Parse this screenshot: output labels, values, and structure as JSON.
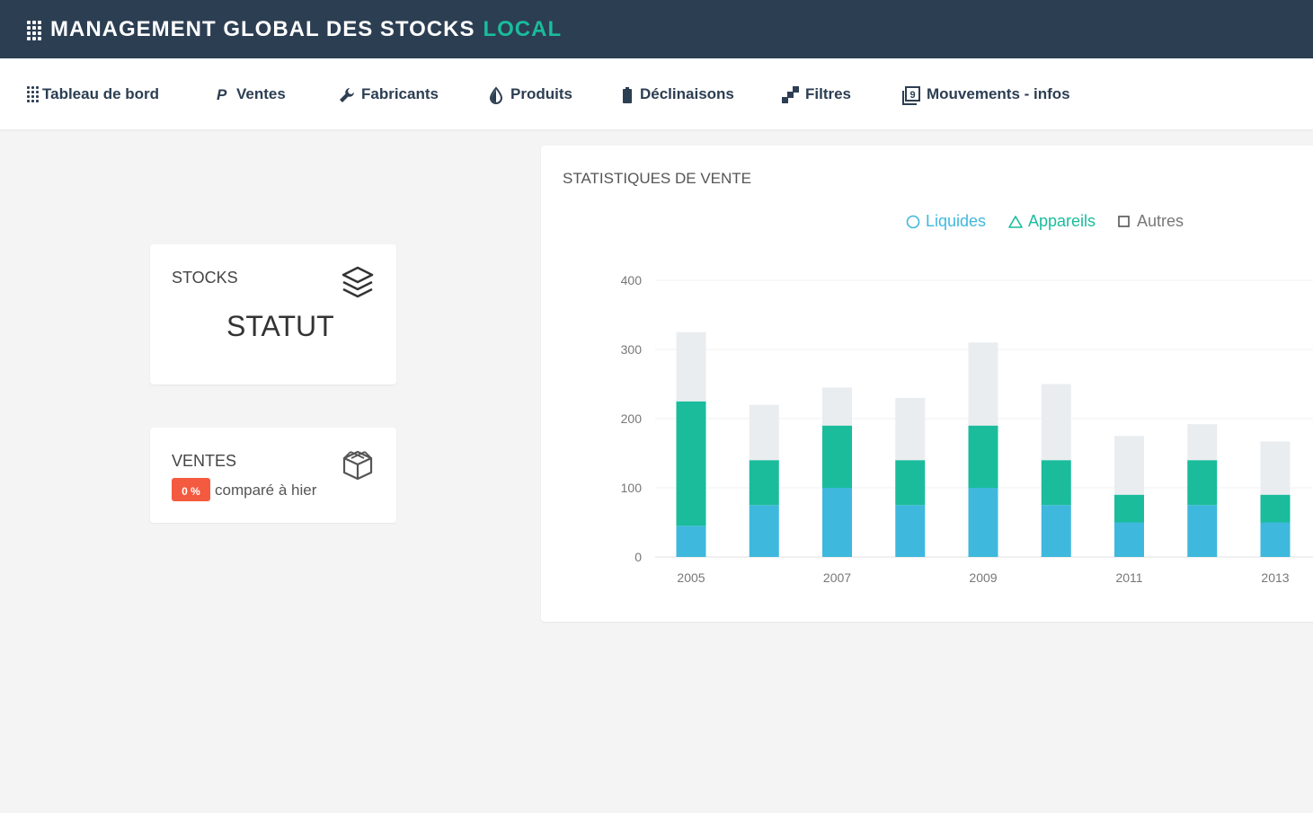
{
  "app": {
    "title": "MANAGEMENT GLOBAL DES STOCKS",
    "title_accent": "LOCAL"
  },
  "nav": {
    "items": [
      {
        "label": "Tableau de bord",
        "icon": "dashboard-grid-icon"
      },
      {
        "label": "Ventes",
        "icon": "paypal-icon"
      },
      {
        "label": "Fabricants",
        "icon": "wrench-icon"
      },
      {
        "label": "Produits",
        "icon": "drop-icon"
      },
      {
        "label": "Déclinaisons",
        "icon": "battery-icon"
      },
      {
        "label": "Filtres",
        "icon": "steps-icon"
      },
      {
        "label": "Mouvements - infos",
        "icon": "number-9-box-icon"
      }
    ]
  },
  "cards": {
    "stocks": {
      "label": "STOCKS",
      "value": "STATUT",
      "icon": "layers-icon"
    },
    "ventes": {
      "label": "VENTES",
      "badge": "0 %",
      "compare": "comparé à hier",
      "icon": "box-icon"
    }
  },
  "chart": {
    "title": "STATISTIQUES DE VENTE",
    "legend": [
      {
        "label": "Liquides",
        "shape": "circle",
        "color": "#3fb8dd"
      },
      {
        "label": "Appareils",
        "shape": "triangle",
        "color": "#1abc9c"
      },
      {
        "label": "Autres",
        "shape": "square",
        "color": "#777777"
      }
    ]
  },
  "chart_data": {
    "type": "bar",
    "stacked": true,
    "x": [
      2005,
      2006,
      2007,
      2008,
      2009,
      2010,
      2011,
      2012,
      2013
    ],
    "x_tick_labels": [
      "2005",
      "2007",
      "2009",
      "2011",
      "2013"
    ],
    "y_ticks": [
      0,
      100,
      200,
      300,
      400
    ],
    "ylim": [
      0,
      400
    ],
    "grid": true,
    "legend_position": "top",
    "series": [
      {
        "name": "Liquides",
        "color": "#3fb8dd",
        "values": [
          45,
          75,
          100,
          75,
          100,
          75,
          50,
          75,
          50
        ]
      },
      {
        "name": "Appareils",
        "color": "#1abc9c",
        "values": [
          180,
          65,
          90,
          65,
          90,
          65,
          40,
          65,
          40
        ]
      },
      {
        "name": "Autres",
        "color": "#eaedf0",
        "values": [
          100,
          80,
          55,
          90,
          120,
          110,
          85,
          52,
          77
        ]
      }
    ]
  }
}
